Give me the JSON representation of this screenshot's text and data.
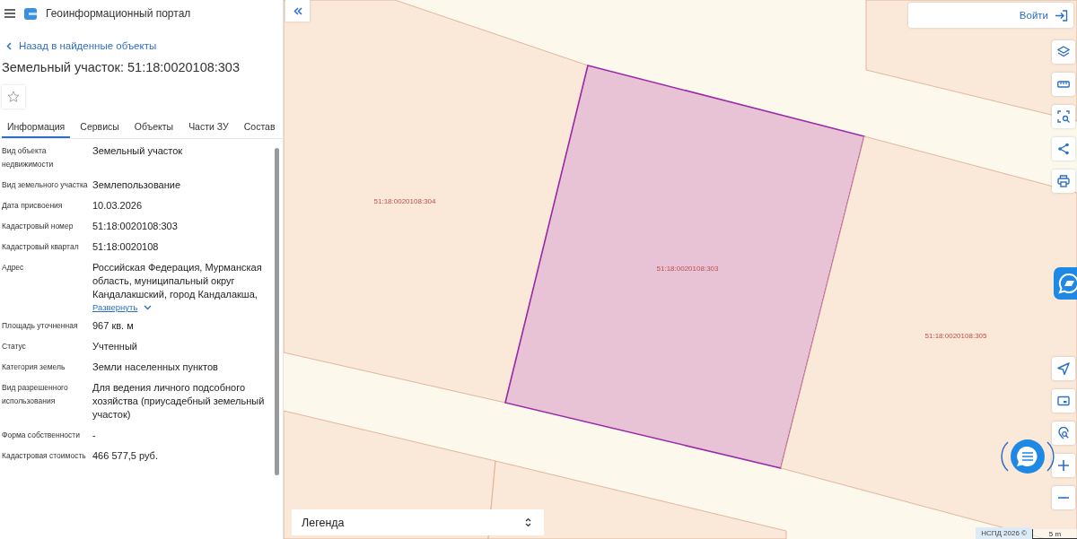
{
  "header": {
    "title": "Геоинформационный портал"
  },
  "back_link": "Назад в найденные объекты",
  "object_title": "Земельный участок: 51:18:0020108:303",
  "favorite": {
    "on": false
  },
  "tabs": [
    {
      "label": "Информация",
      "selected": true
    },
    {
      "label": "Сервисы",
      "selected": false
    },
    {
      "label": "Объекты",
      "selected": false
    },
    {
      "label": "Части ЗУ",
      "selected": false
    },
    {
      "label": "Состав",
      "selected": false
    }
  ],
  "info_rows": [
    {
      "label": "Вид объекта недвижимости",
      "value": "Земельный участок"
    },
    {
      "label": "Вид земельного участка",
      "value": "Землепользование"
    },
    {
      "label": "Дата присвоения",
      "value": "10.03.2026"
    },
    {
      "label": "Кадастровый номер",
      "value": "51:18:0020108:303"
    },
    {
      "label": "Кадастровый квартал",
      "value": "51:18:0020108"
    },
    {
      "label": "Адрес",
      "value": "Российская Федерация, Мурманская область, муниципальный округ Кандалакшский, город Кандалакша,",
      "expand_link": "Развернуть"
    },
    {
      "label": "Площадь уточненная",
      "value": "967 кв. м"
    },
    {
      "label": "Статус",
      "value": "Учтенный"
    },
    {
      "label": "Категория земель",
      "value": "Земли населенных пунктов"
    },
    {
      "label": "Вид разрешенного использования",
      "value": "Для ведения личного подсобного хозяйства (приусадебный земельный участок)"
    },
    {
      "label": "Форма собственности",
      "value": "-"
    },
    {
      "label": "Кадастровая стоимость",
      "value": "466 577,5 руб."
    }
  ],
  "map": {
    "login_button": "Войти",
    "parcels": [
      {
        "label": "51:18:0020108:304",
        "selected": false
      },
      {
        "label": "51:18:0020108:303",
        "selected": true
      },
      {
        "label": "51:18:0020108:305",
        "selected": false
      }
    ],
    "legend": "Легенда",
    "attribution": "НСПД 2026 ©",
    "scale": "5 m"
  }
}
